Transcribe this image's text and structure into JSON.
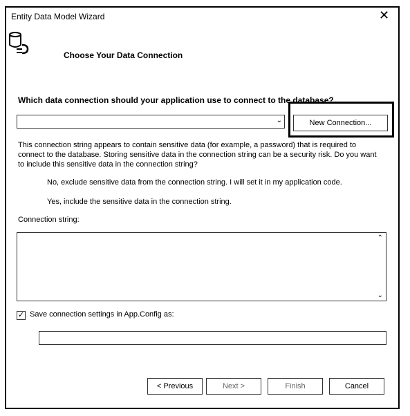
{
  "window": {
    "title": "Entity Data Model Wizard"
  },
  "header": {
    "heading": "Choose Your Data Connection"
  },
  "connection": {
    "question": "Which data connection should your application use to connect to the database?",
    "selected": "",
    "new_button": "New Connection..."
  },
  "sensitive": {
    "warning": "This connection string appears to contain sensitive data (for example, a password) that is required to connect to the database. Storing sensitive data in the connection string can be a security risk. Do you want to include this sensitive data in the connection string?",
    "option_exclude": "No, exclude sensitive data from the connection string. I will set it in my application code.",
    "option_include": "Yes, include the sensitive data in the connection string."
  },
  "conn_string": {
    "label": "Connection string:",
    "value": ""
  },
  "save": {
    "checked": true,
    "label": "Save connection settings in App.Config as:",
    "value": ""
  },
  "buttons": {
    "previous": "< Previous",
    "next": "Next >",
    "finish": "Finish",
    "cancel": "Cancel"
  },
  "icons": {
    "close": "close-icon",
    "wizard": "database-connection-icon",
    "checkmark": "checkmark-icon"
  }
}
